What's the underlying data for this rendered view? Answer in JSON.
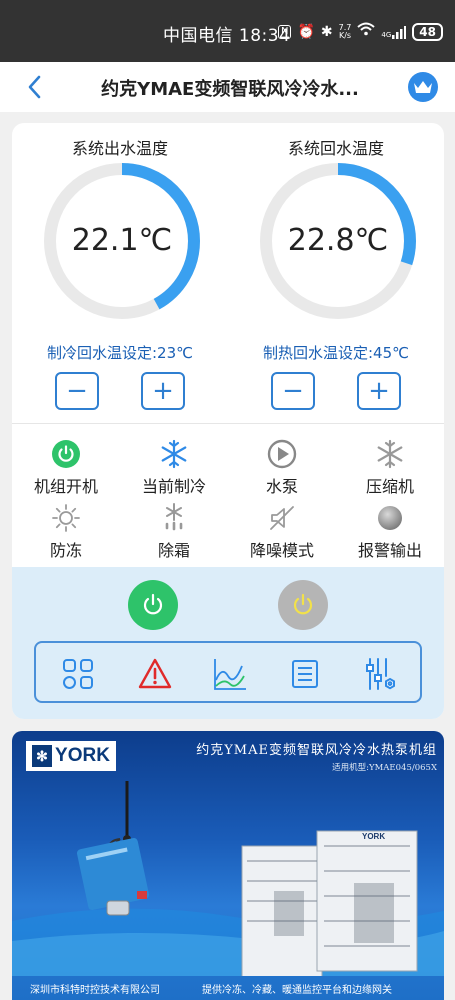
{
  "status_bar": {
    "carrier_time": "中国电信 18:34",
    "nfc": "N",
    "speed_value": "7.7",
    "speed_unit": "K/s",
    "signal_label": "4G",
    "battery": "48"
  },
  "header": {
    "title": "约克YMAE变频智联风冷冷水..."
  },
  "gauges": [
    {
      "label": "系统出水温度",
      "value": "22.1℃",
      "level": 0.42,
      "setpoint": "制冷回水温设定:23℃"
    },
    {
      "label": "系统回水温度",
      "value": "22.8℃",
      "level": 0.3,
      "setpoint": "制热回水温设定:45℃"
    }
  ],
  "buttons": {
    "minus": "−",
    "plus": "+"
  },
  "status_items": [
    {
      "label": "机组开机",
      "icon": "power-on-icon"
    },
    {
      "label": "当前制冷",
      "icon": "snowflake-icon"
    },
    {
      "label": "水泵",
      "icon": "pump-play-icon"
    },
    {
      "label": "压缩机",
      "icon": "compressor-snowflake-icon"
    },
    {
      "label": "防冻",
      "icon": "sun-icon"
    },
    {
      "label": "除霜",
      "icon": "defrost-icon"
    },
    {
      "label": "降噪模式",
      "icon": "mute-speaker-icon"
    },
    {
      "label": "报警输出",
      "icon": "alarm-dot-icon"
    }
  ],
  "controls": {
    "power_on_color": "#2ec36a",
    "power_off_color": "#b5b5b5",
    "accent": "#2f8ae6",
    "tools": [
      "grid-icon",
      "alert-triangle-icon",
      "chart-icon",
      "list-icon",
      "sliders-icon"
    ]
  },
  "banner": {
    "logo": "YORK",
    "title": "约克YMAE变频智联风冷冷水热泵机组",
    "subtitle": "适用机型:YMAE045/065X",
    "footer_left": "深圳市科特时控技术有限公司",
    "footer_right": "提供冷冻、冷藏、暖通监控平台和边缘网关",
    "unit_brand": "YORK"
  }
}
